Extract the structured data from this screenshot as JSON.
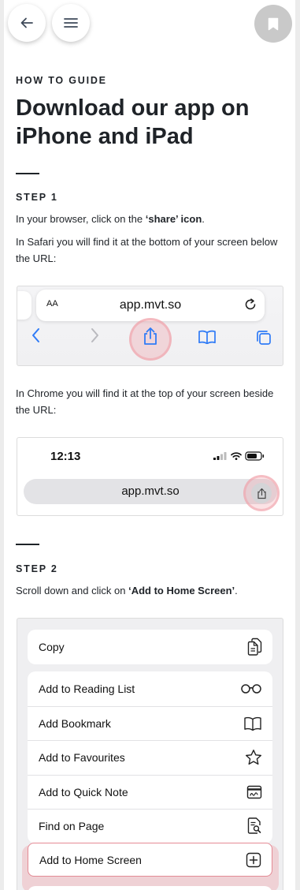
{
  "nav": {
    "back_icon": "arrow-left-icon",
    "menu_icon": "hamburger-icon",
    "bookmark_icon": "bookmark-icon"
  },
  "eyebrow": "HOW TO GUIDE",
  "title": "Download our app on iPhone and iPad",
  "steps": [
    {
      "label": "STEP 1",
      "intro_before": "In your browser, click on the ",
      "intro_bold": "‘share’ icon",
      "intro_after": ".",
      "safari_text": "In Safari you will find it at the bottom of your screen below the URL:",
      "chrome_text": "In Chrome you will find it at the top of your screen beside the URL:"
    },
    {
      "label": "STEP 2",
      "intro_before": "Scroll down and click on ",
      "intro_bold": "‘Add to Home Screen’",
      "intro_after": "."
    }
  ],
  "safari": {
    "aa": "AA",
    "url": "app.mvt.so",
    "toolbar_icons": [
      "chevron-left-icon",
      "chevron-right-icon",
      "share-icon",
      "book-icon",
      "tabs-icon"
    ]
  },
  "chrome": {
    "time": "12:13",
    "url": "app.mvt.so"
  },
  "share_menu": {
    "copy": {
      "label": "Copy",
      "icon": "copy-icon"
    },
    "items": [
      {
        "label": "Add to Reading List",
        "icon": "glasses-icon"
      },
      {
        "label": "Add Bookmark",
        "icon": "book-icon"
      },
      {
        "label": "Add to Favourites",
        "icon": "star-icon"
      },
      {
        "label": "Add to Quick Note",
        "icon": "quick-note-icon"
      },
      {
        "label": "Find on Page",
        "icon": "find-icon"
      }
    ],
    "highlighted": {
      "label": "Add to Home Screen",
      "icon": "plus-square-icon"
    }
  },
  "colors": {
    "text": "#1f2328",
    "ios_blue": "#2f7bf6",
    "highlight": "#ee8c96"
  }
}
